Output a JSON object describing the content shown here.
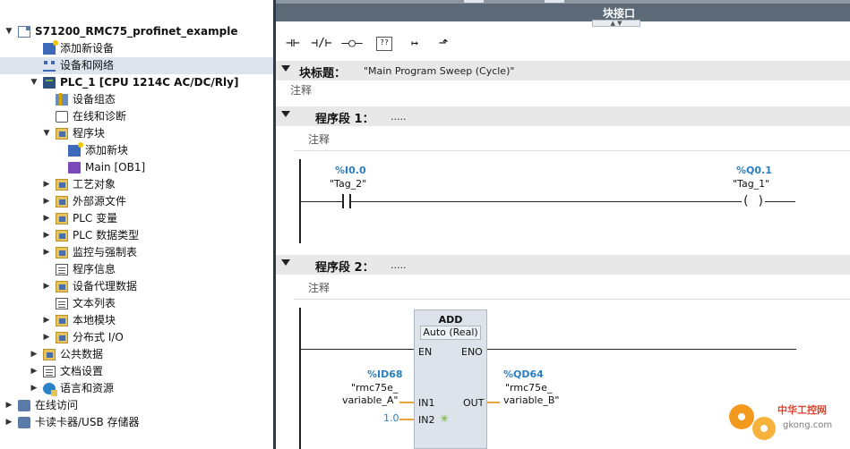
{
  "tree": {
    "items": [
      {
        "label": "S71200_RMC75_profinet_example",
        "toggle": "▼",
        "icon": "project-icon"
      },
      {
        "label": "添加新设备",
        "toggle": "",
        "icon": "add-device-icon"
      },
      {
        "label": "设备和网络",
        "toggle": "",
        "icon": "network-icon"
      },
      {
        "label": "PLC_1 [CPU 1214C AC/DC/Rly]",
        "toggle": "▼",
        "icon": "plc-icon"
      },
      {
        "label": "设备组态",
        "toggle": "",
        "icon": "device-config-icon"
      },
      {
        "label": "在线和诊断",
        "toggle": "",
        "icon": "diagnostics-icon"
      },
      {
        "label": "程序块",
        "toggle": "▼",
        "icon": "folder-icon"
      },
      {
        "label": "添加新块",
        "toggle": "",
        "icon": "add-block-icon"
      },
      {
        "label": "Main [OB1]",
        "toggle": "",
        "icon": "ob-icon"
      },
      {
        "label": "工艺对象",
        "toggle": "▶",
        "icon": "folder-icon"
      },
      {
        "label": "外部源文件",
        "toggle": "▶",
        "icon": "folder-icon"
      },
      {
        "label": "PLC 变量",
        "toggle": "▶",
        "icon": "folder-icon"
      },
      {
        "label": "PLC 数据类型",
        "toggle": "▶",
        "icon": "folder-icon"
      },
      {
        "label": "监控与强制表",
        "toggle": "▶",
        "icon": "folder-icon"
      },
      {
        "label": "程序信息",
        "toggle": "",
        "icon": "table-icon"
      },
      {
        "label": "设备代理数据",
        "toggle": "▶",
        "icon": "folder-icon"
      },
      {
        "label": "文本列表",
        "toggle": "",
        "icon": "table-icon"
      },
      {
        "label": "本地模块",
        "toggle": "▶",
        "icon": "folder-icon"
      },
      {
        "label": "分布式 I/O",
        "toggle": "▶",
        "icon": "folder-icon"
      },
      {
        "label": "公共数据",
        "toggle": "▶",
        "icon": "folder-icon"
      },
      {
        "label": "文档设置",
        "toggle": "▶",
        "icon": "table-icon"
      },
      {
        "label": "语言和资源",
        "toggle": "▶",
        "icon": "web-icon"
      },
      {
        "label": "在线访问",
        "toggle": "▶",
        "icon": "card-icon"
      },
      {
        "label": "卡读卡器/USB 存储器",
        "toggle": "▶",
        "icon": "card-icon"
      }
    ]
  },
  "editor": {
    "interface_title": "块接口",
    "toolbar": [
      "⊣⊢",
      "⊣/⊢",
      "–○–",
      "??",
      "↦",
      "⬏"
    ],
    "block_title": {
      "label": "块标题：",
      "value": "\"Main Program Sweep (Cycle)\"",
      "comment": "注释"
    },
    "networks": [
      {
        "label": "程序段 1：",
        "dots": ".....",
        "comment": "注释",
        "contact": {
          "address": "%I0.0",
          "tag": "\"Tag_2\""
        },
        "coil": {
          "address": "%Q0.1",
          "tag": "\"Tag_1\"",
          "symbol": "( )"
        }
      },
      {
        "label": "程序段 2：",
        "dots": ".....",
        "comment": "注释",
        "box": {
          "title": "ADD",
          "type": "Auto (Real)",
          "en": "EN",
          "eno": "ENO",
          "in1": "IN1",
          "in2": "IN2",
          "out": "OUT",
          "in1_address": "%ID68",
          "in1_tag_1": "\"rmc75e_",
          "in1_tag_2": "variable_A\"",
          "in2_value": "1.0",
          "out_address": "%QD64",
          "out_tag_1": "\"rmc75e_",
          "out_tag_2": "variable_B\""
        }
      }
    ]
  },
  "watermark": {
    "text": "中华工控网",
    "url": "gkong.com"
  }
}
